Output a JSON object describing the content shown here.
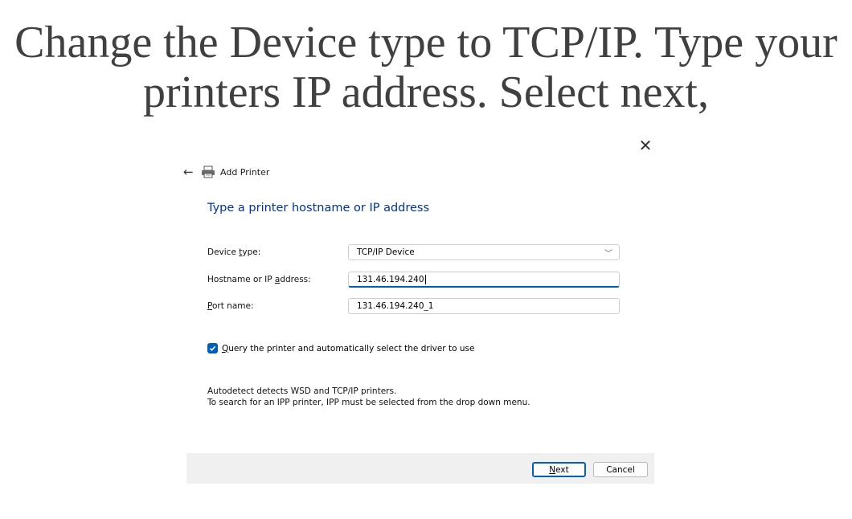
{
  "slide": {
    "title_line1": "Change the Device type to TCP/IP. Type your",
    "title_line2": "printers IP address. Select next,"
  },
  "dialog": {
    "window_title": "Add Printer",
    "heading": "Type a printer hostname or IP address",
    "device_type": {
      "label_pre": "Device ",
      "label_accel": "t",
      "label_post": "ype:",
      "value": "TCP/IP Device"
    },
    "hostname": {
      "label_pre": "Hostname or IP ",
      "label_accel": "a",
      "label_post": "ddress:",
      "value": "131.46.194.240"
    },
    "port_name": {
      "label_accel": "P",
      "label_post": "ort name:",
      "value": "131.46.194.240_1"
    },
    "query_checkbox": {
      "accel": "Q",
      "label_post": "uery the printer and automatically select the driver to use",
      "checked": true
    },
    "note_line1": "Autodetect detects WSD and TCP/IP printers.",
    "note_line2": "To search for an IPP printer, IPP must be selected from the drop down menu.",
    "next_button": {
      "accel": "N",
      "label_post": "ext"
    },
    "cancel_button": "Cancel"
  },
  "icons": [
    "close-icon",
    "back-arrow-icon",
    "printer-icon",
    "chevron-down-icon",
    "checkmark-icon"
  ],
  "colors": {
    "heading": "#003399",
    "accent": "#005fb8",
    "footer": "#f0f0f0",
    "slide_title": "#404040"
  }
}
